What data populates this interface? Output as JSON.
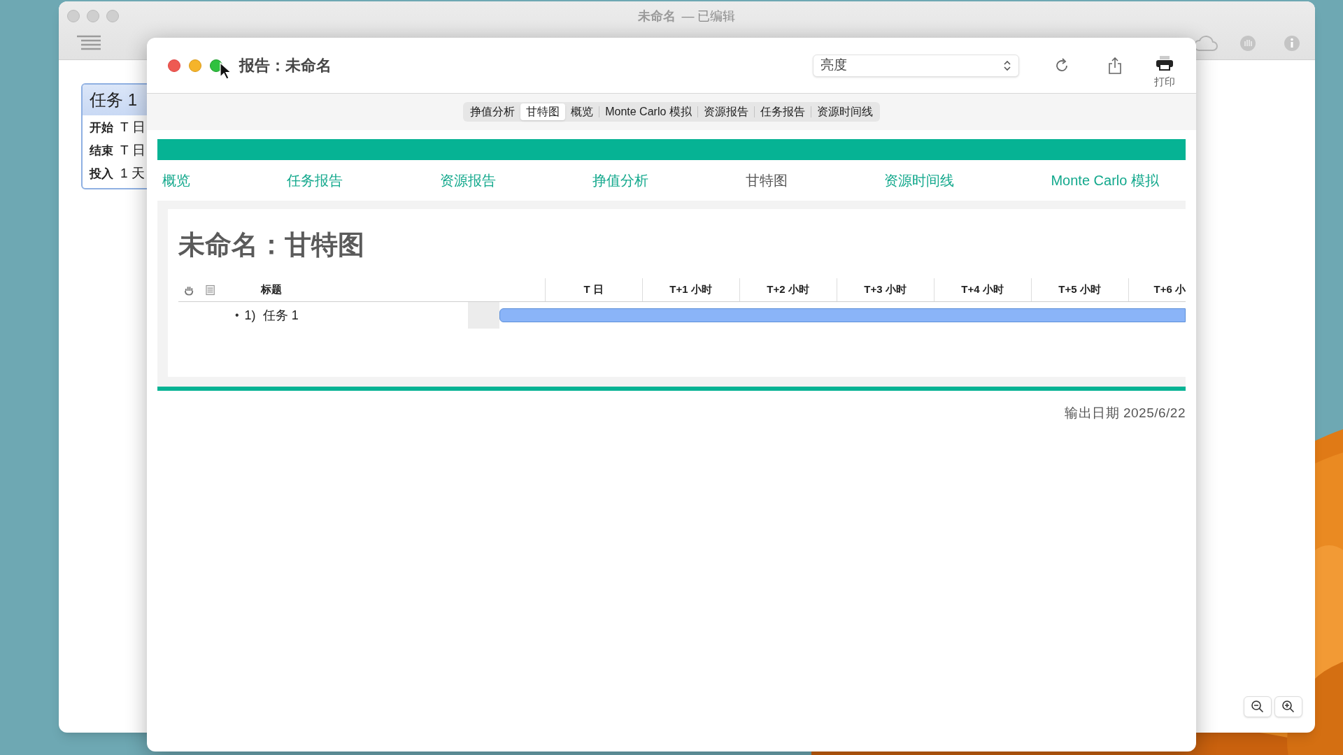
{
  "background_window": {
    "title": "未命名",
    "subtitle": "— 已编辑",
    "task_card": {
      "title": "任务 1",
      "rows": [
        {
          "label": "开始",
          "value": "T 日"
        },
        {
          "label": "结束",
          "value": "T 日"
        },
        {
          "label": "投入",
          "value": "1 天"
        }
      ]
    }
  },
  "dialog": {
    "title": "报告：未命名",
    "style_popup": {
      "value": "亮度"
    },
    "print_label": "打印",
    "segments": [
      {
        "label": "挣值分析",
        "selected": false
      },
      {
        "label": "甘特图",
        "selected": true
      },
      {
        "label": "概览",
        "selected": false
      },
      {
        "label": "Monte Carlo 模拟",
        "selected": false
      },
      {
        "label": "资源报告",
        "selected": false
      },
      {
        "label": "任务报告",
        "selected": false
      },
      {
        "label": "资源时间线",
        "selected": false
      }
    ],
    "nav_links": [
      {
        "label": "概览",
        "selected": false
      },
      {
        "label": "任务报告",
        "selected": false
      },
      {
        "label": "资源报告",
        "selected": false
      },
      {
        "label": "挣值分析",
        "selected": false
      },
      {
        "label": "甘特图",
        "selected": true
      },
      {
        "label": "资源时间线",
        "selected": false
      },
      {
        "label": "Monte Carlo 模拟",
        "selected": false
      }
    ],
    "report_title": "未命名：甘特图",
    "gantt": {
      "title_column": "标题",
      "time_columns": [
        "T 日",
        "T+1 小时",
        "T+2 小时",
        "T+3 小时",
        "T+4 小时",
        "T+5 小时",
        "T+6 小"
      ],
      "rows": [
        {
          "bullet": "•",
          "number": "1)",
          "title": "任务 1"
        }
      ]
    },
    "export_date": "输出日期 2025/6/22"
  }
}
